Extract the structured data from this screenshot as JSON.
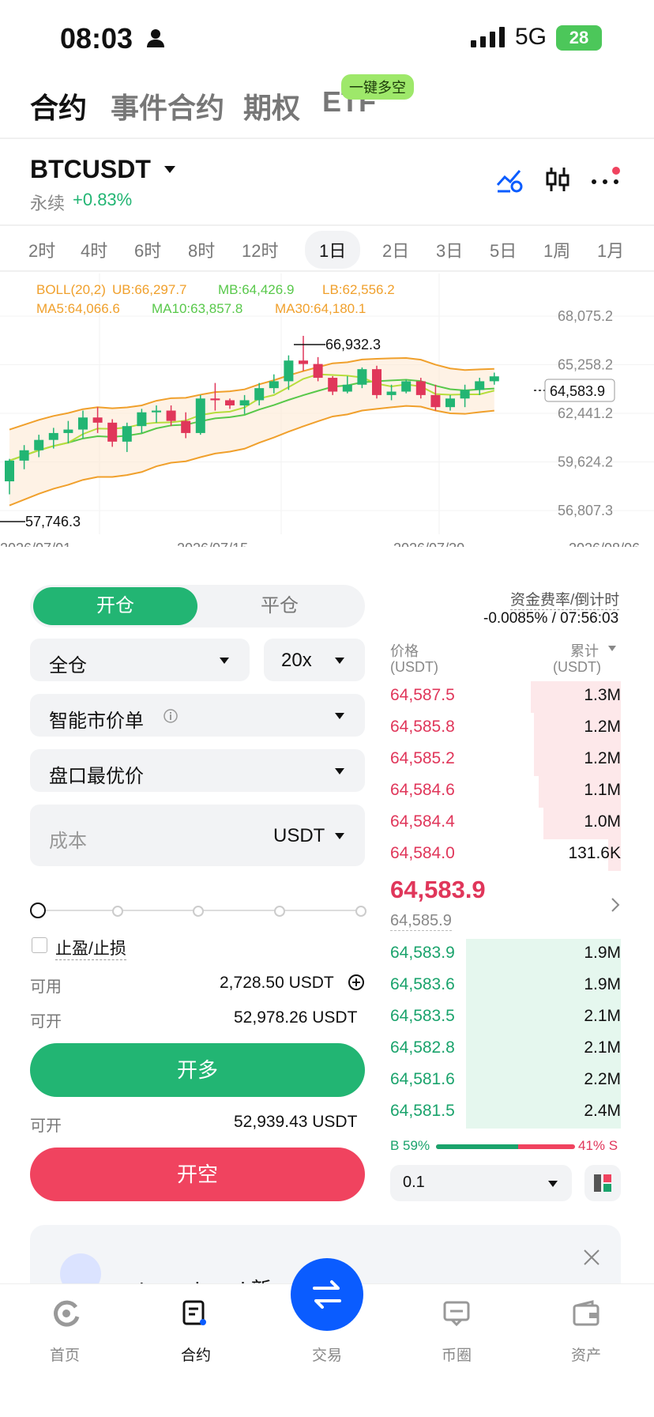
{
  "status_bar": {
    "time": "08:03",
    "network": "5G",
    "battery": "28"
  },
  "top_tabs": [
    "合约",
    "事件合约",
    "期权",
    "ETF"
  ],
  "promo_badge": "一键多空",
  "pair": {
    "symbol": "BTCUSDT",
    "type": "永续",
    "change": "+0.83%"
  },
  "intervals": [
    "2时",
    "4时",
    "6时",
    "8时",
    "12时",
    "1日",
    "2日",
    "3日",
    "5日",
    "1周",
    "1月"
  ],
  "active_interval": "1日",
  "chart_data": {
    "type": "candlestick",
    "indicators": {
      "boll": "BOLL(20,2)",
      "ub": "UB:66,297.7",
      "mb": "MB:64,426.9",
      "lb": "LB:62,556.2",
      "ma5": "MA5:64,066.6",
      "ma10": "MA10:63,857.8",
      "ma30": "MA30:64,180.1"
    },
    "y_ticks": [
      "68,075.2",
      "65,258.2",
      "62,441.2",
      "59,624.2",
      "56,807.3"
    ],
    "x_ticks": [
      "2026/07/01",
      "2026/07/15",
      "2026/07/30",
      "2026/08/06"
    ],
    "high_label": "66,932.3",
    "low_label": "57,746.3",
    "last_price": "64,583.9",
    "candles": [
      [
        58500,
        57746,
        59800,
        59700
      ],
      [
        59700,
        59200,
        60600,
        60300
      ],
      [
        60300,
        59900,
        61200,
        60900
      ],
      [
        60900,
        60400,
        61600,
        61300
      ],
      [
        61300,
        60700,
        62000,
        61500
      ],
      [
        61500,
        61000,
        62600,
        62200
      ],
      [
        62200,
        61300,
        62800,
        61900
      ],
      [
        61900,
        60500,
        62100,
        60800
      ],
      [
        60800,
        60200,
        61900,
        61700
      ],
      [
        61700,
        61300,
        62700,
        62500
      ],
      [
        62500,
        61900,
        62900,
        62600
      ],
      [
        62600,
        61700,
        62900,
        62000
      ],
      [
        62000,
        61000,
        62500,
        61300
      ],
      [
        61300,
        61200,
        63500,
        63300
      ],
      [
        63300,
        62600,
        64200,
        63200
      ],
      [
        63200,
        62700,
        63300,
        62900
      ],
      [
        62900,
        62400,
        63500,
        63200
      ],
      [
        63200,
        62900,
        64200,
        63900
      ],
      [
        63900,
        63600,
        64700,
        64300
      ],
      [
        64300,
        63800,
        65800,
        65500
      ],
      [
        65500,
        64900,
        66932,
        65300
      ],
      [
        65300,
        64300,
        65700,
        64500
      ],
      [
        64500,
        63500,
        64600,
        63700
      ],
      [
        63700,
        63600,
        64600,
        64100
      ],
      [
        64100,
        63900,
        65100,
        65000
      ],
      [
        65000,
        63300,
        65200,
        63500
      ],
      [
        63500,
        63200,
        64100,
        63700
      ],
      [
        63700,
        63600,
        64400,
        64300
      ],
      [
        64300,
        63300,
        64500,
        63500
      ],
      [
        63500,
        62600,
        64100,
        62800
      ],
      [
        62800,
        62600,
        63500,
        63300
      ],
      [
        63300,
        62800,
        64100,
        63800
      ],
      [
        63800,
        63500,
        64500,
        64300
      ],
      [
        64300,
        64100,
        64800,
        64584
      ]
    ]
  },
  "trade_panel": {
    "open_tab": "开仓",
    "close_tab": "平仓",
    "margin_mode": "全仓",
    "leverage": "20x",
    "order_type": "智能市价单",
    "price_type": "盘口最优价",
    "cost_placeholder": "成本",
    "cost_unit": "USDT",
    "tpsl_label": "止盈/止损",
    "available_label": "可用",
    "available_value": "2,728.50 USDT",
    "open_label": "可开",
    "long_max": "52,978.26 USDT",
    "long_button": "开多",
    "short_max": "52,939.43 USDT",
    "short_button": "开空"
  },
  "funding": {
    "label": "资金费率/倒计时",
    "value": "-0.0085% / 07:56:03"
  },
  "orderbook": {
    "price_header": "价格",
    "price_unit": "(USDT)",
    "total_header": "累计",
    "total_unit": "(USDT)",
    "asks": [
      {
        "price": "64,587.5",
        "qty": "1.3M",
        "depth": 0.58
      },
      {
        "price": "64,585.8",
        "qty": "1.2M",
        "depth": 0.56
      },
      {
        "price": "64,585.2",
        "qty": "1.2M",
        "depth": 0.56
      },
      {
        "price": "64,584.6",
        "qty": "1.1M",
        "depth": 0.53
      },
      {
        "price": "64,584.4",
        "qty": "1.0M",
        "depth": 0.5
      },
      {
        "price": "64,584.0",
        "qty": "131.6K",
        "depth": 0.08
      }
    ],
    "last_price": "64,583.9",
    "mark_price": "64,585.9",
    "bids": [
      {
        "price": "64,583.9",
        "qty": "1.9M",
        "depth": 1.0
      },
      {
        "price": "64,583.6",
        "qty": "1.9M",
        "depth": 1.0
      },
      {
        "price": "64,583.5",
        "qty": "2.1M",
        "depth": 1.0
      },
      {
        "price": "64,582.8",
        "qty": "2.1M",
        "depth": 1.0
      },
      {
        "price": "64,581.6",
        "qty": "2.2M",
        "depth": 1.0
      },
      {
        "price": "64,581.5",
        "qty": "2.4M",
        "depth": 1.0
      }
    ],
    "buy_ratio": "B 59%",
    "sell_ratio": "41% S",
    "buy_fraction": 0.59,
    "precision": "0.1"
  },
  "banner": {
    "text": "Launchpool 新 ..."
  },
  "bottom_nav": [
    "首页",
    "合约",
    "交易",
    "币圈",
    "资产"
  ],
  "colors": {
    "green": "#22b573",
    "red": "#f0435f",
    "accent": "#0a5cff"
  }
}
